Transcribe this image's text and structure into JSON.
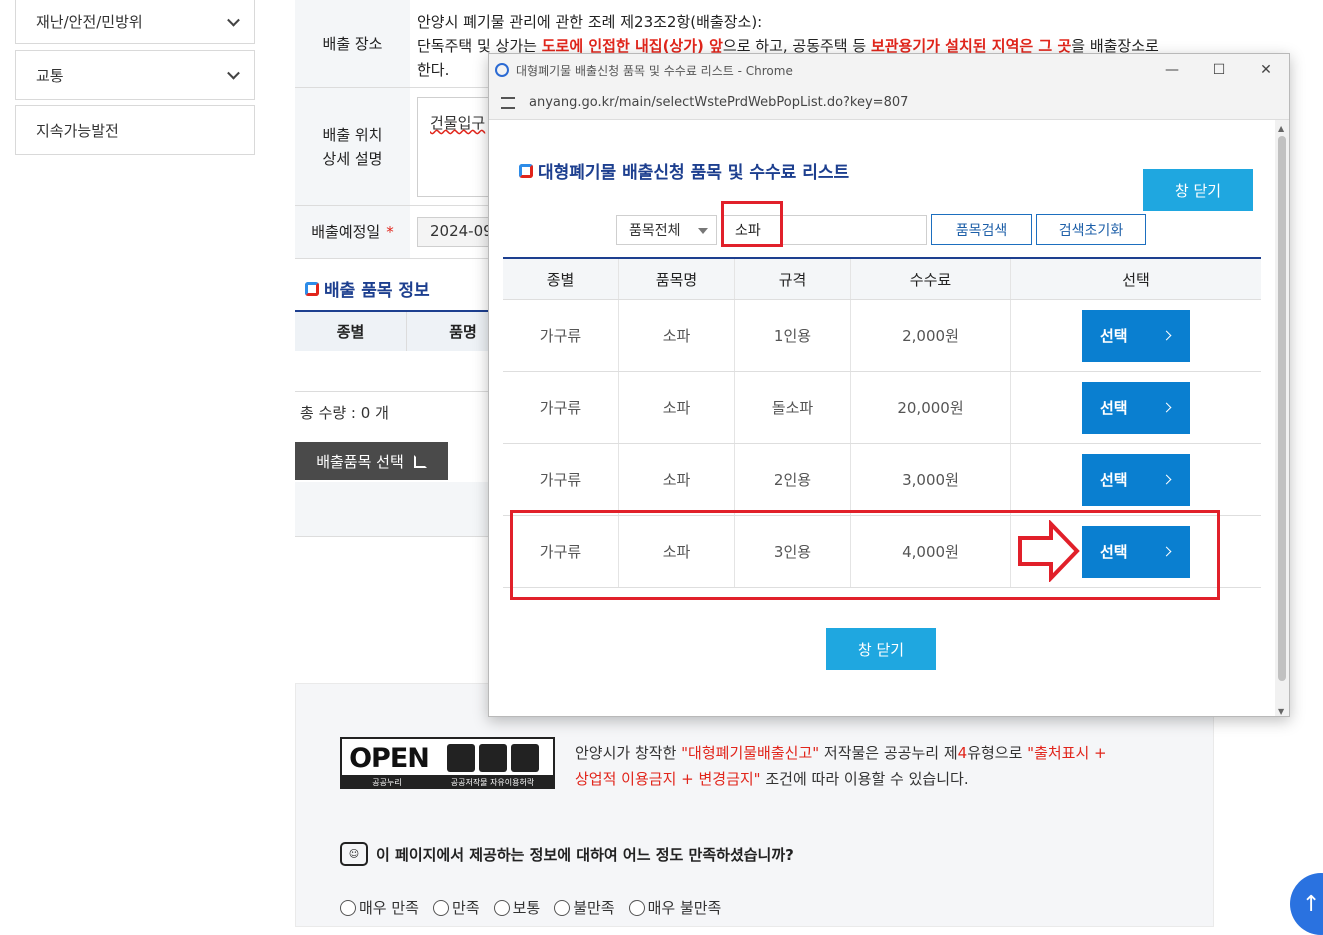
{
  "sidebar": {
    "items": [
      {
        "label": "재난/안전/민방위",
        "expandable": true
      },
      {
        "label": "교통",
        "expandable": true
      },
      {
        "label": "지속가능발전",
        "expandable": false
      }
    ]
  },
  "form": {
    "place_label": "배출 장소",
    "place_desc_line1": "안양시 폐기물 관리에 관한 조례 제23조2항(배출장소):",
    "place_desc_p1": "단독주택 및 상가는 ",
    "place_desc_red1": "도로에 인접한 내집(상가) 앞",
    "place_desc_p2": "으로 하고, 공동주택 등 ",
    "place_desc_red2": "보관용기가 설치된 지역은 그 곳",
    "place_desc_p3": "을 배출장소로",
    "place_desc_line3": "한다.",
    "location_label_1": "배출 위치",
    "location_label_2": "상세 설명",
    "location_value": "건물입구",
    "date_label": "배출예정일",
    "date_required_mark": "*",
    "date_value": "2024-09"
  },
  "items_section": {
    "title": "배출 품목 정보",
    "headers": [
      "종별",
      "품명"
    ],
    "total": "총 수량 : 0 개",
    "select_button": "배출품목 선택"
  },
  "footer": {
    "open_logo": "OPEN",
    "open_sub": "공공누리",
    "open_right_sub": "공공저작물 자유이용허락",
    "license_p1": "안양시가 창작한 ",
    "license_red1": "\"대형폐기물배출신고\"",
    "license_p2": " 저작물은 공공누리 제",
    "license_red2": "4",
    "license_p3": "유형으로 ",
    "license_red3": "\"출처표시 +",
    "license_red4": "상업적 이용금지 + 변경금지\"",
    "license_p4": " 조건에 따라 이용할 수 있습니다.",
    "survey_question": "이 페이지에서 제공하는 정보에 대하여 어느 정도 만족하셨습니까?",
    "survey_options": [
      "매우 만족",
      "만족",
      "보통",
      "불만족",
      "매우 불만족"
    ],
    "top_button": "↑"
  },
  "popup": {
    "window_title": "대형폐기물 배출신청 품목 및 수수료 리스트 - Chrome",
    "url": "anyang.go.kr/main/selectWstePrdWebPopList.do?key=807",
    "controls": {
      "minimize": "—",
      "maximize": "☐",
      "close": "✕"
    },
    "heading": "대형폐기물 배출신청 품목 및 수수료 리스트",
    "close_label": "창 닫기",
    "category_select": "품목전체",
    "search_value": "소파",
    "search_button": "품목검색",
    "reset_button": "검색초기화",
    "table": {
      "headers": [
        "종별",
        "품목명",
        "규격",
        "수수료",
        "선택"
      ],
      "rows": [
        {
          "type": "가구류",
          "name": "소파",
          "spec": "1인용",
          "fee": "2,000원",
          "action": "선택"
        },
        {
          "type": "가구류",
          "name": "소파",
          "spec": "돌소파",
          "fee": "20,000원",
          "action": "선택"
        },
        {
          "type": "가구류",
          "name": "소파",
          "spec": "2인용",
          "fee": "3,000원",
          "action": "선택"
        },
        {
          "type": "가구류",
          "name": "소파",
          "spec": "3인용",
          "fee": "4,000원",
          "action": "선택"
        }
      ]
    }
  },
  "annotations": {
    "highlight_color": "#e1202a"
  }
}
